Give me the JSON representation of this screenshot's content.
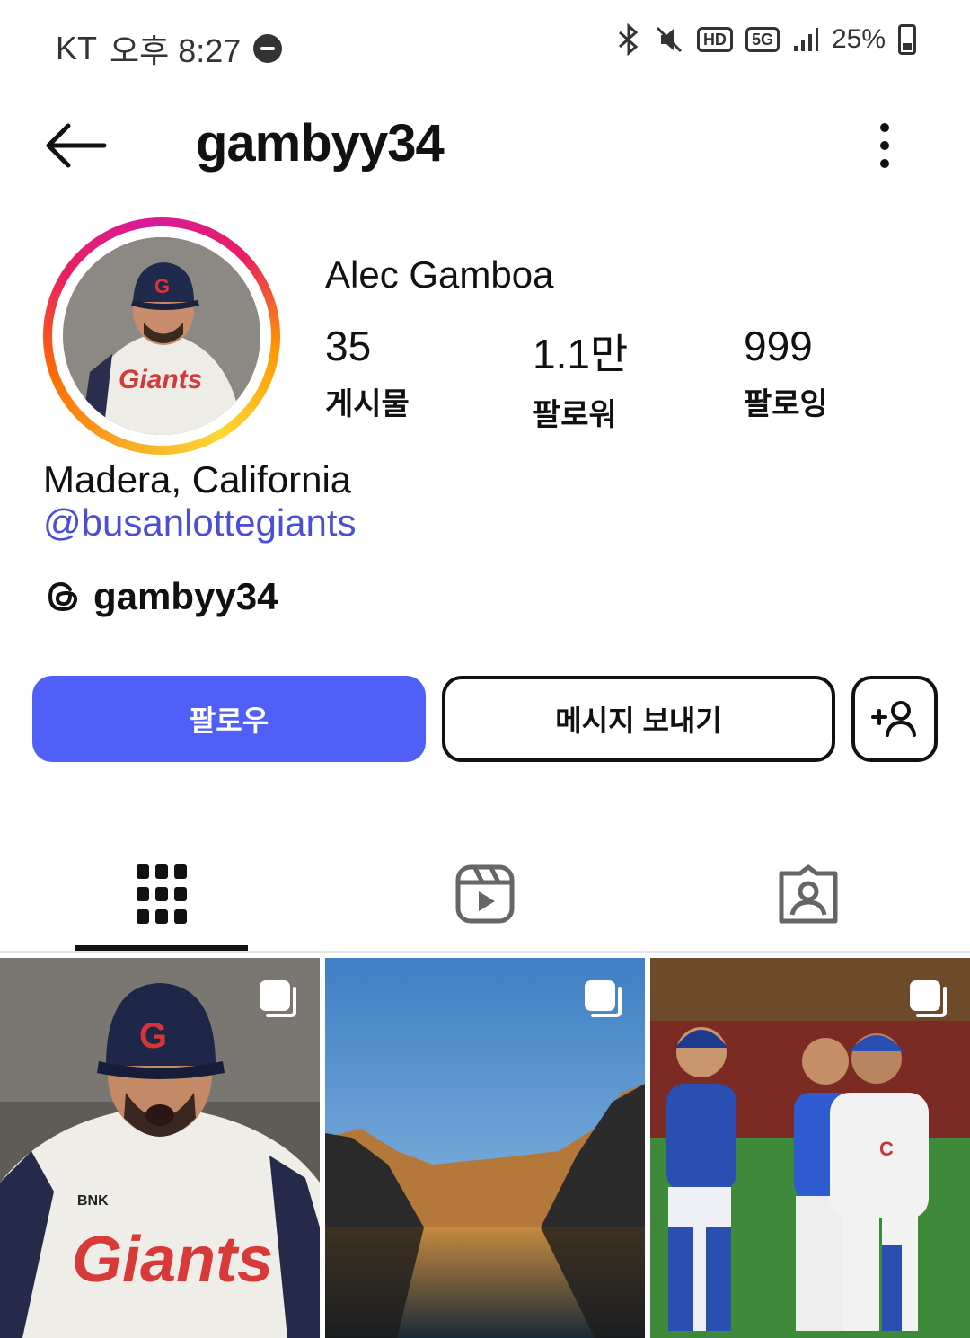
{
  "status_bar": {
    "carrier": "KT",
    "time": "오후 8:27",
    "battery": "25%",
    "hd_label": "HD",
    "network_label": "5G"
  },
  "header": {
    "title": "gambyy34"
  },
  "profile": {
    "full_name": "Alec Gamboa",
    "stats": [
      {
        "value": "35",
        "label": "게시물"
      },
      {
        "value": "1.1만",
        "label": "팔로워"
      },
      {
        "value": "999",
        "label": "팔로잉"
      }
    ],
    "location": "Madera, California",
    "mention": "@busanlottegiants",
    "threads_handle": "gambyy34"
  },
  "actions": {
    "follow": "팔로우",
    "message": "메시지 보내기"
  },
  "tabs": [
    {
      "name": "grid-icon",
      "active": true
    },
    {
      "name": "reels-icon",
      "active": false
    },
    {
      "name": "tagged-icon",
      "active": false
    }
  ],
  "colors": {
    "accent": "#4f5ff7",
    "link": "#4a4fd6"
  },
  "posts": [
    {
      "icon": "carousel-icon"
    },
    {
      "icon": "carousel-icon"
    },
    {
      "icon": "carousel-icon"
    }
  ]
}
